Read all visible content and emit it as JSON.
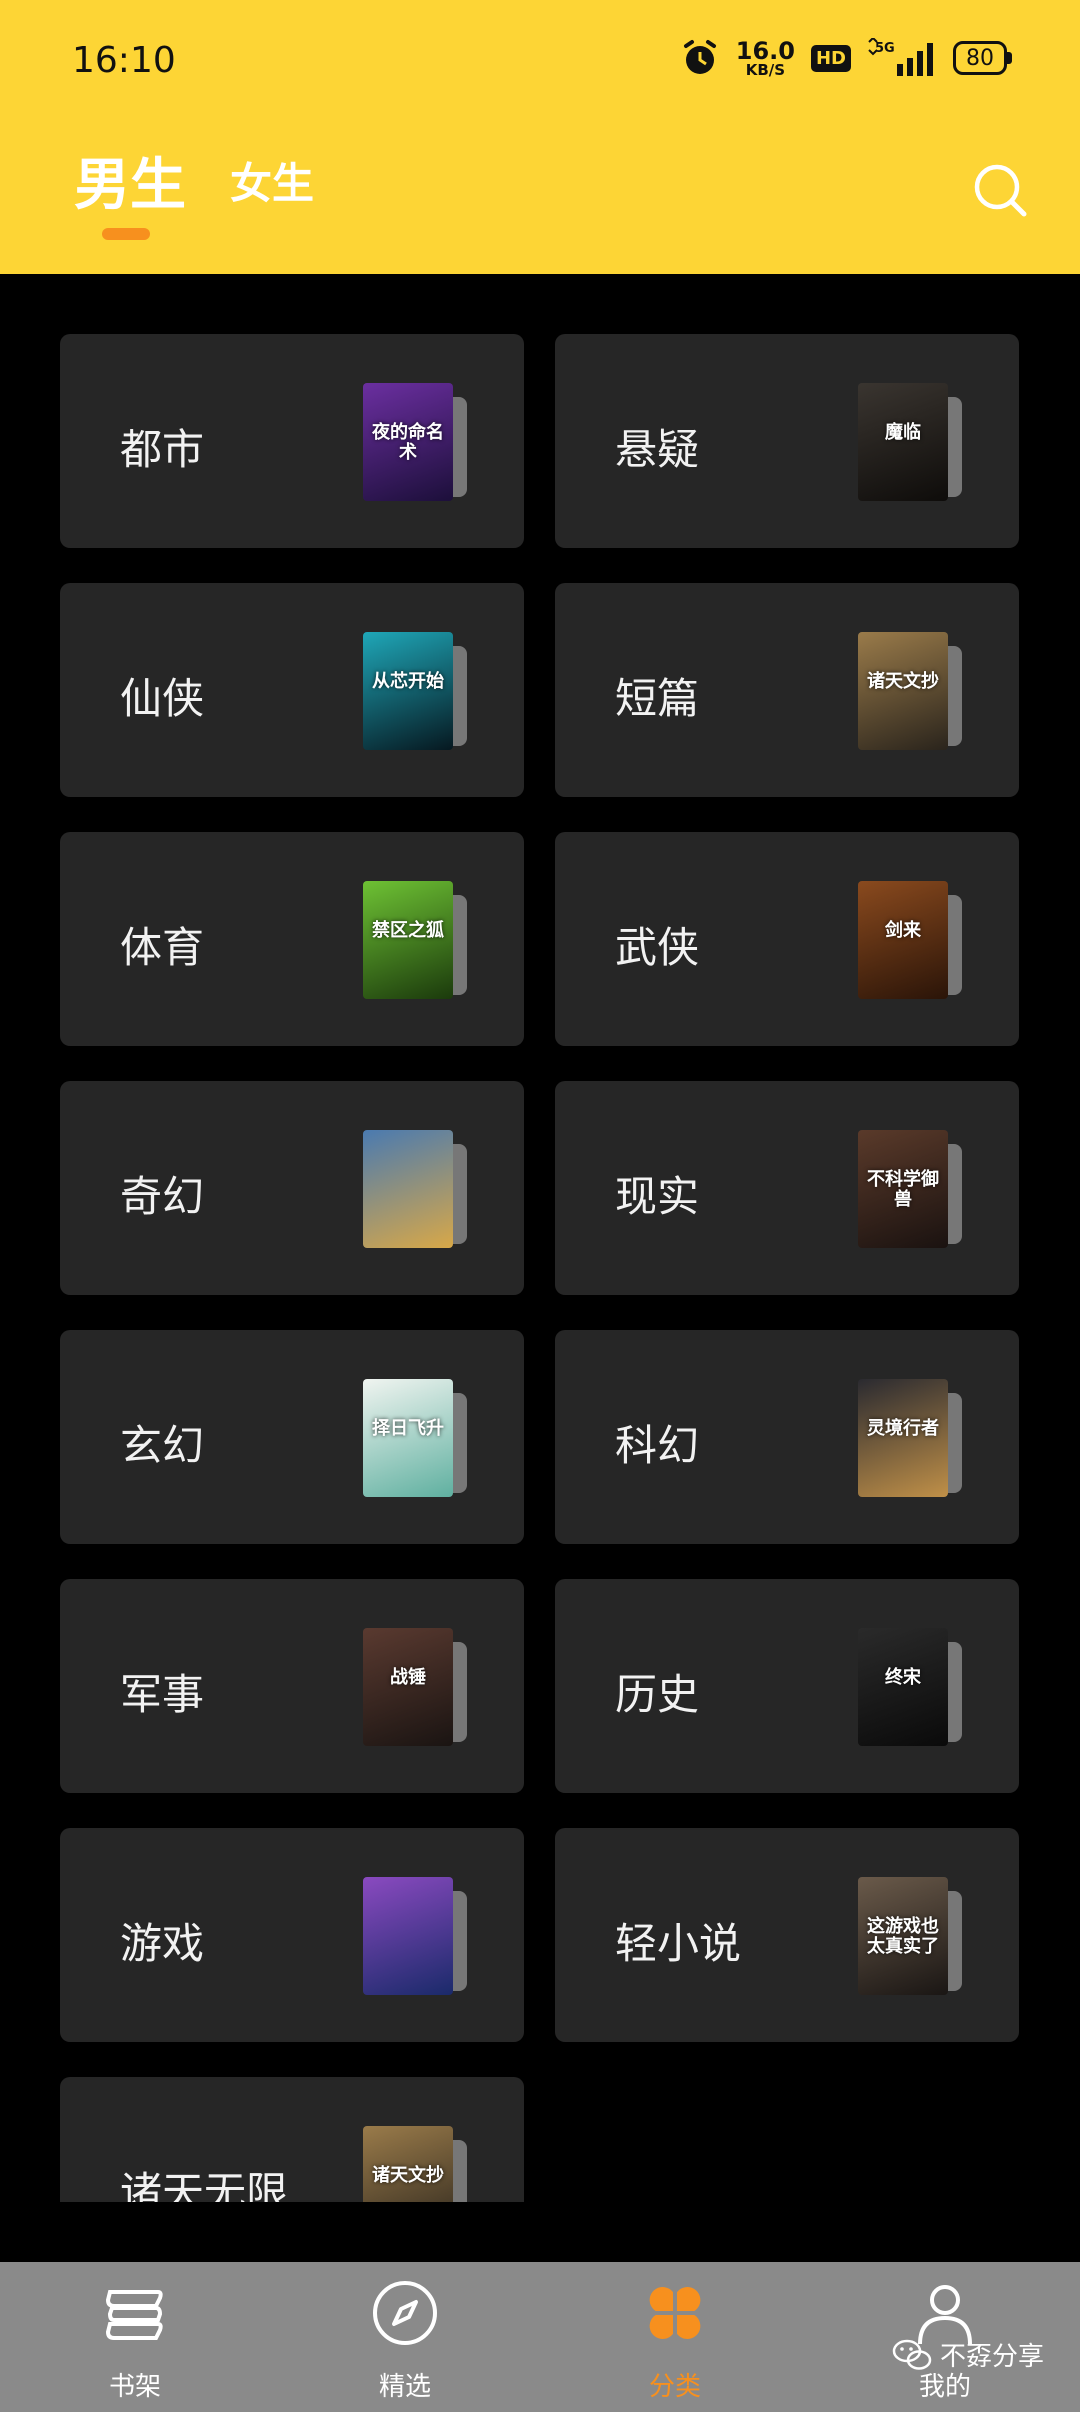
{
  "status": {
    "time": "16:10",
    "net_speed": "16.0",
    "net_unit": "KB/S",
    "hd": "HD",
    "network": "5G",
    "battery": "80"
  },
  "tabs": {
    "male": "男生",
    "female": "女生",
    "active": "男生"
  },
  "colors": {
    "header": "#fdd535",
    "accent": "#f7901e",
    "card": "#262626",
    "nav": "#8a8a8a"
  },
  "categories": [
    {
      "label": "都市",
      "cover_text": "夜的命名术",
      "cover_colors": [
        "#6b2fa0",
        "#1c0f3a"
      ]
    },
    {
      "label": "悬疑",
      "cover_text": "魔临",
      "cover_colors": [
        "#3a3530",
        "#0e0c0a"
      ]
    },
    {
      "label": "仙侠",
      "cover_text": "从芯开始",
      "cover_colors": [
        "#1fa7b8",
        "#061820"
      ]
    },
    {
      "label": "短篇",
      "cover_text": "诸天文抄",
      "cover_colors": [
        "#9a7b4a",
        "#2a241c"
      ]
    },
    {
      "label": "体育",
      "cover_text": "禁区之狐",
      "cover_colors": [
        "#6ec234",
        "#1b3a0c"
      ]
    },
    {
      "label": "武侠",
      "cover_text": "剑来",
      "cover_colors": [
        "#8a4a1e",
        "#2a1408"
      ]
    },
    {
      "label": "奇幻",
      "cover_text": "",
      "cover_colors": [
        "#4a7ab0",
        "#d8a848"
      ]
    },
    {
      "label": "现实",
      "cover_text": "不科学御兽",
      "cover_colors": [
        "#5a3a2a",
        "#1a1210"
      ]
    },
    {
      "label": "玄幻",
      "cover_text": "择日飞升",
      "cover_colors": [
        "#f0f4f0",
        "#5fb0a0"
      ]
    },
    {
      "label": "科幻",
      "cover_text": "灵境行者",
      "cover_colors": [
        "#2a2a30",
        "#c09048"
      ]
    },
    {
      "label": "军事",
      "cover_text": "战锤",
      "cover_colors": [
        "#5a3a30",
        "#1a1412"
      ]
    },
    {
      "label": "历史",
      "cover_text": "终宋",
      "cover_colors": [
        "#2a2a2a",
        "#0a0a0a"
      ]
    },
    {
      "label": "游戏",
      "cover_text": "",
      "cover_colors": [
        "#8a4ac0",
        "#1a2a6a"
      ]
    },
    {
      "label": "轻小说",
      "cover_text": "这游戏也太真实了",
      "cover_colors": [
        "#6a5a4a",
        "#1a1614"
      ]
    },
    {
      "label": "诸天无限",
      "cover_text": "诸天文抄",
      "cover_colors": [
        "#9a7b4a",
        "#2a241c"
      ]
    }
  ],
  "nav": [
    {
      "label": "书架",
      "icon": "bookshelf-icon",
      "active": false
    },
    {
      "label": "精选",
      "icon": "compass-icon",
      "active": false
    },
    {
      "label": "分类",
      "icon": "category-icon",
      "active": true
    },
    {
      "label": "我的",
      "icon": "profile-icon",
      "active": false
    }
  ],
  "watermark": {
    "text": "不孬分享",
    "icon": "wechat-icon"
  }
}
